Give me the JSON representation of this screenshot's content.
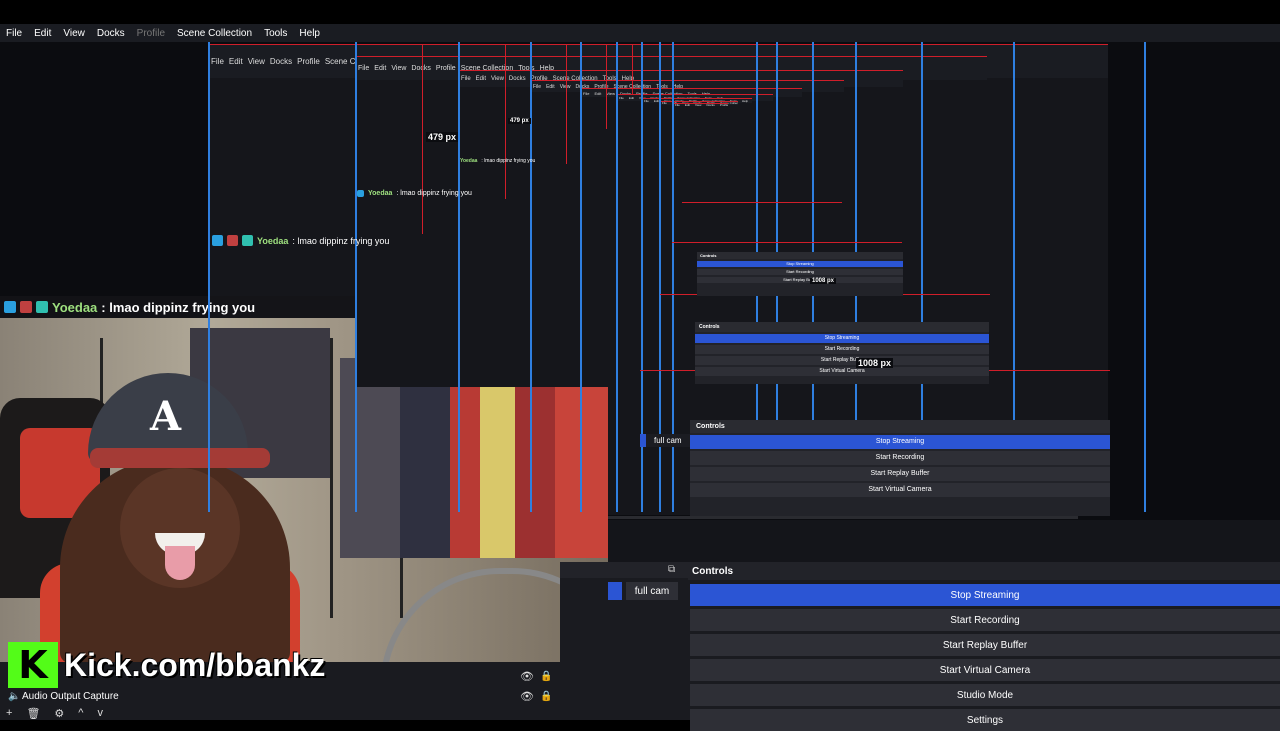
{
  "menu": [
    {
      "label": "File"
    },
    {
      "label": "Edit"
    },
    {
      "label": "View"
    },
    {
      "label": "Docks"
    },
    {
      "label": "Profile",
      "disabled": true
    },
    {
      "label": "Scene Collection"
    },
    {
      "label": "Tools"
    },
    {
      "label": "Help"
    }
  ],
  "canvas": {
    "measure_vertical": "479 px",
    "measure_horizontal": "1008 px",
    "chat": {
      "user": "Yoedaa",
      "message": ": lmao dippinz frying you"
    },
    "mini_controls": {
      "title": "Controls",
      "scene_label": "full cam",
      "buttons": [
        "Stop Streaming",
        "Start Recording",
        "Start Replay Buffer",
        "Start Virtual Camera",
        "Studio Mode"
      ]
    }
  },
  "overlay": {
    "kick_logo": "K",
    "kick_text": "Kick.com/bbankz"
  },
  "sources": {
    "items": [
      {
        "label": "",
        "visible": true,
        "locked": true
      },
      {
        "label": "Audio Output Capture",
        "visible": true,
        "locked": true
      }
    ],
    "toolbar": [
      "+",
      "🗑",
      "⚙",
      "^",
      "v"
    ]
  },
  "scenes": {
    "selected": "full cam"
  },
  "controls": {
    "title": "Controls",
    "buttons": [
      {
        "label": "Stop Streaming",
        "active": true
      },
      {
        "label": "Start Recording",
        "active": false
      },
      {
        "label": "Start Replay Buffer",
        "active": false
      },
      {
        "label": "Start Virtual Camera",
        "active": false
      },
      {
        "label": "Studio Mode",
        "active": false
      },
      {
        "label": "Settings",
        "active": false
      }
    ]
  },
  "colors": {
    "accent_blue": "#2b55d4",
    "guide_red": "#d01e2a",
    "guide_blue": "#2f7fe0",
    "kick_green": "#53fc18"
  }
}
